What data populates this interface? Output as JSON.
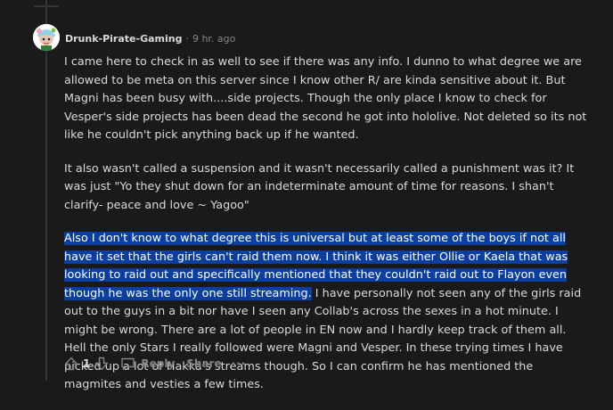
{
  "comment": {
    "author": "Drunk-Pirate-Gaming",
    "separator": "·",
    "time": "9 hr. ago",
    "paragraphs": {
      "p1": "I came here to check in as well to see if there was any info. I dunno to what degree we are allowed to be meta on this server since I know other R/ are kinda sensitive about it. But Magni has been busy with....side projects. Though the only place I know to check for Vesper's side projects has been dead the second he got into hololive. Not deleted so its not like he couldn't pick anything back up if he wanted.",
      "p2": "It also wasn't called a suspension and it wasn't necessarily called a punishment was it? It was just \"Yo they shut down for an indeterminate amount of time for reasons. I shan't clarify- peace and love ~ Yagoo\"",
      "p3_selected": "Also I don't know to what degree this is universal but at least some of the boys if not all have it set that the girls can't raid them now. I think it was either Ollie or Kaela that was looking to raid out and specifically mentioned that they couldn't raid out to Flayon even though he was the only one still streaming.",
      "p3_rest": " I have personally not seen any of the girls raid out to the guys in a bit nor have I seen any Collab's across the sexes in a hot minute. I might be wrong. There are a lot of people in EN now and I hardly keep track of them all. Hell the only Stars I really followed were Magni and Vesper. In these trying times I have picked up a lot of Hakka's streams though. So I can confirm he has mentioned the magmites and vesties a few times."
    }
  },
  "actions": {
    "upvote_icon": "upvote-icon",
    "vote_count": "1",
    "downvote_icon": "downvote-icon",
    "reply_icon": "reply-icon",
    "reply_label": "Reply",
    "share_label": "Share",
    "more_label": "···"
  },
  "colors": {
    "background": "#1a1a1b",
    "text": "#d7dadc",
    "muted": "#818384",
    "selection": "#0b3ea1"
  }
}
